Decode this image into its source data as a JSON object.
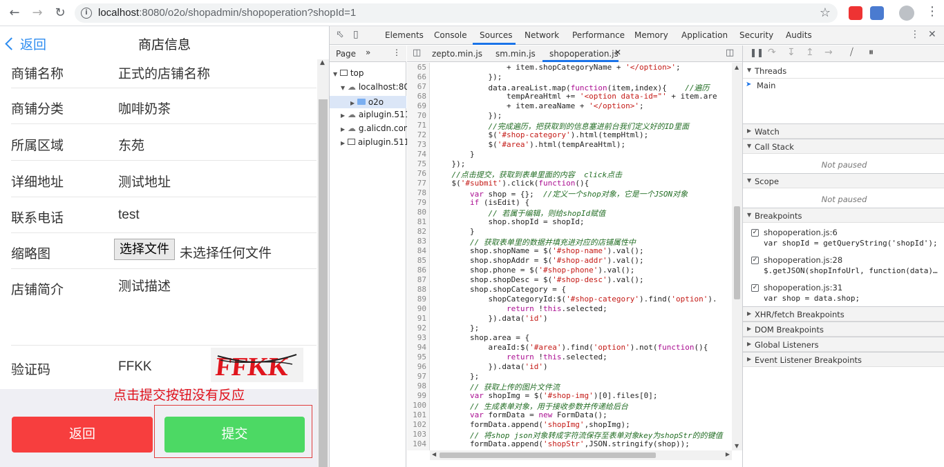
{
  "browser": {
    "url_host": "localhost",
    "url_path": ":8080/o2o/shopadmin/shopoperation?shopId=1",
    "back_icon": "arrow-left-icon",
    "forward_icon": "arrow-right-icon",
    "reload_icon": "reload-icon",
    "info_icon": "info-icon",
    "star_icon": "star-icon"
  },
  "mobile": {
    "back_label": "返回",
    "title": "商店信息",
    "rows": [
      {
        "label": "商铺名称",
        "value": "正式的店铺名称"
      },
      {
        "label": "商铺分类",
        "value": "咖啡奶茶"
      },
      {
        "label": "所属区域",
        "value": "东苑"
      },
      {
        "label": "详细地址",
        "value": "测试地址"
      },
      {
        "label": "联系电话",
        "value": "test"
      },
      {
        "label": "缩略图",
        "value": ""
      },
      {
        "label": "店铺简介",
        "value": "测试描述"
      },
      {
        "label": "验证码",
        "value": "FFKK"
      }
    ],
    "file_button": "选择文件",
    "file_status": "未选择任何文件",
    "captcha_text": "FFKK",
    "annotation": "点击提交按钮没有反应",
    "back_button": "返回",
    "submit_button": "提交",
    "back_color": "#f73e3e",
    "submit_color": "#4cd964"
  },
  "devtools": {
    "tabs": [
      "Elements",
      "Console",
      "Sources",
      "Network",
      "Performance",
      "Memory",
      "Application",
      "Security",
      "Audits"
    ],
    "active_tab": "Sources",
    "navigator": {
      "tab": "Page",
      "tree": [
        "top",
        "localhost:80",
        "o2o",
        "aiplugin.511",
        "g.alicdn.con",
        "aiplugin.511"
      ]
    },
    "editor_tabs": [
      "zepto.min.js",
      "sm.min.js",
      "shopoperation.js"
    ],
    "active_file": "shopoperation.js",
    "code_start_line": 65,
    "code": [
      "                + item.shopCategoryName + '</option>';",
      "            });",
      "            data.areaList.map(function(item,index){    //遍历",
      "                tempAreaHtml += '<option data-id=\"' + item.are",
      "                + item.areaName + '</option>';",
      "            });",
      "            //完成遍历，把获取到的信息塞进前台我们定义好的ID里面",
      "            $('#shop-category').html(tempHtml);",
      "            $('#area').html(tempAreaHtml);",
      "        }",
      "    });",
      "    //点击提交，获取到表单里面的内容  click点击",
      "    $('#submit').click(function(){",
      "        var shop = {};  //定义一个shop对象，它是一个JSON对象",
      "        if (isEdit) {",
      "            // 若属于编辑，则给shopId赋值",
      "            shop.shopId = shopId;",
      "        }",
      "        // 获取表单里的数据并填充进对应的店铺属性中",
      "        shop.shopName = $('#shop-name').val();",
      "        shop.shopAddr = $('#shop-addr').val();",
      "        shop.phone = $('#shop-phone').val();",
      "        shop.shopDesc = $('#shop-desc').val();",
      "        shop.shopCategory = {",
      "            shopCategoryId:$('#shop-category').find('option').",
      "                return !this.selected;",
      "            }).data('id')",
      "        };",
      "        shop.area = {",
      "            areaId:$('#area').find('option').not(function(){",
      "                return !this.selected;",
      "            }).data('id')",
      "        };",
      "        // 获取上传的图片文件流",
      "        var shopImg = $('#shop-img')[0].files[0];",
      "        // 生成表单对象，用于接收参数并传递给后台",
      "        var formData = new FormData();",
      "        formData.append('shopImg',shopImg);",
      "        // 将shop json对象转成字符流保存至表单对象key为shopStr的的键值",
      "        formData.append('shopStr',JSON.stringify(shop));"
    ],
    "debugger": {
      "threads_label": "Threads",
      "thread_main": "Main",
      "watch_label": "Watch",
      "callstack_label": "Call Stack",
      "not_paused": "Not paused",
      "scope_label": "Scope",
      "breakpoints_label": "Breakpoints",
      "breakpoints": [
        {
          "file": "shopoperation.js:6",
          "code": "var shopId = getQueryString('shopId');"
        },
        {
          "file": "shopoperation.js:28",
          "code": "$.getJSON(shopInfoUrl, function(data)…"
        },
        {
          "file": "shopoperation.js:31",
          "code": "var shop = data.shop;"
        }
      ],
      "xhr_label": "XHR/fetch Breakpoints",
      "dom_label": "DOM Breakpoints",
      "global_label": "Global Listeners",
      "event_label": "Event Listener Breakpoints"
    }
  }
}
